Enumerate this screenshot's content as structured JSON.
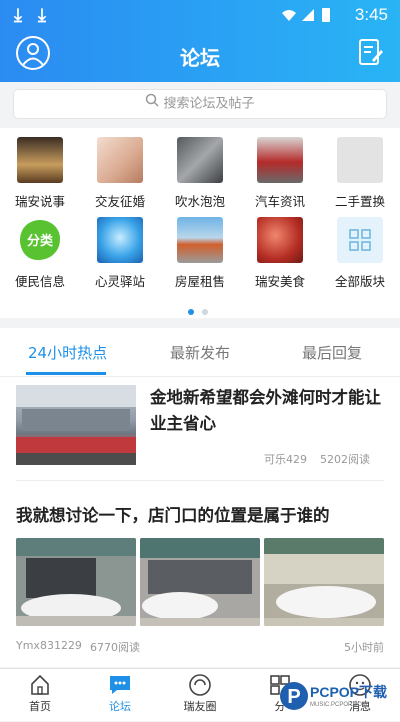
{
  "status_bar": {
    "time": "3:45"
  },
  "header": {
    "title": "论坛"
  },
  "search": {
    "placeholder": "搜索论坛及帖子"
  },
  "categories": [
    {
      "label": "瑞安说事"
    },
    {
      "label": "交友征婚"
    },
    {
      "label": "吹水泡泡"
    },
    {
      "label": "汽车资讯"
    },
    {
      "label": "二手置换"
    },
    {
      "label": "便民信息",
      "icon_text": "分类"
    },
    {
      "label": "心灵驿站"
    },
    {
      "label": "房屋租售"
    },
    {
      "label": "瑞安美食"
    },
    {
      "label": "全部版块"
    }
  ],
  "pager": {
    "pages": 2,
    "current": 1
  },
  "tabs": [
    {
      "label": "24小时热点",
      "active": true
    },
    {
      "label": "最新发布",
      "active": false
    },
    {
      "label": "最后回复",
      "active": false
    }
  ],
  "posts": [
    {
      "title": "金地新希望都会外滩何时才能让业主省心",
      "author": "可乐429",
      "views": "5202阅读"
    },
    {
      "title": "我就想讨论一下，店门口的位置是属于谁的",
      "author": "Ymx831229",
      "views": "6770阅读",
      "time": "5小时前"
    }
  ],
  "bottom_nav": [
    {
      "label": "首页",
      "active": false
    },
    {
      "label": "论坛",
      "active": true
    },
    {
      "label": "瑞友圈",
      "active": false
    },
    {
      "label": "分",
      "active": false
    },
    {
      "label": "消息",
      "active": false
    }
  ],
  "watermark": {
    "text": "PCPOP下载",
    "sub": "MUSIC.PCPOP.COM"
  },
  "colors": {
    "accent": "#1e90e8",
    "header_start": "#2b8bf2",
    "header_end": "#29b4f5"
  }
}
